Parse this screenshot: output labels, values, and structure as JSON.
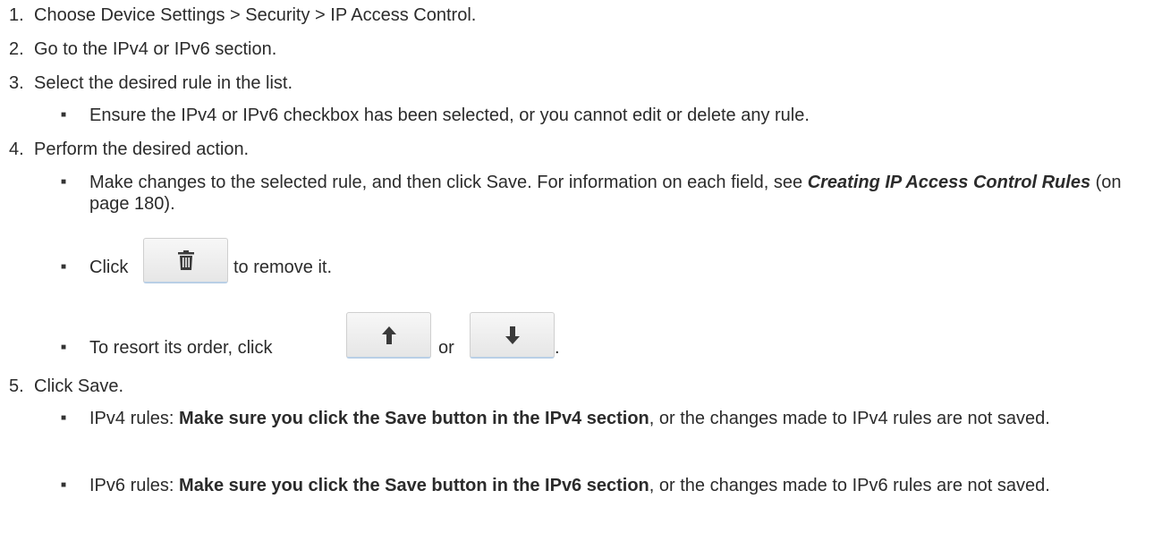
{
  "steps": [
    {
      "num": "1.",
      "text": "Choose Device Settings > Security > IP Access Control."
    },
    {
      "num": "2.",
      "text": "Go to the IPv4 or IPv6 section."
    },
    {
      "num": "3.",
      "text": "Select the desired rule in the list."
    },
    {
      "num": "4.",
      "text": "Perform the desired action."
    },
    {
      "num": "5.",
      "text": "Click Save."
    }
  ],
  "bullets": {
    "ensure": "Ensure the IPv4 or IPv6 checkbox has been selected, or you cannot edit or delete any rule.",
    "make_changes_a": "Make changes to the selected rule, and then click Save. For information on each field, see ",
    "make_changes_ref": "Creating IP Access Control Rules",
    "make_changes_b": " (on page 180).",
    "click": "Click",
    "to_remove": "to remove it.",
    "resort": "To resort its order, click",
    "or": "or",
    "period": ".",
    "ipv4_prefix": "IPv4 rules: ",
    "ipv4_bold": "Make sure you click the Save button in the IPv4 section",
    "ipv4_suffix": ", or the changes made to IPv4 rules are not saved.",
    "ipv6_prefix": "IPv6 rules: ",
    "ipv6_bold": "Make sure you click the Save button in the IPv6 section",
    "ipv6_suffix": ", or the changes made to IPv6 rules are not saved."
  },
  "icons": {
    "delete": "trash-icon",
    "move_up": "arrow-up-icon",
    "move_down": "arrow-down-icon"
  }
}
